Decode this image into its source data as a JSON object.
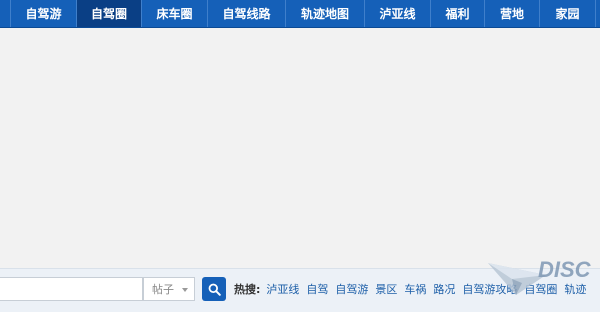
{
  "nav": {
    "items": [
      {
        "label": "自驾游",
        "active": false
      },
      {
        "label": "自驾圈",
        "active": true
      },
      {
        "label": "床车圈",
        "active": false
      },
      {
        "label": "自驾线路",
        "active": false
      },
      {
        "label": "轨迹地图",
        "active": false
      },
      {
        "label": "泸亚线",
        "active": false
      },
      {
        "label": "福利",
        "active": false
      },
      {
        "label": "营地",
        "active": false
      },
      {
        "label": "家园",
        "active": false
      }
    ]
  },
  "search": {
    "type_label": "帖子",
    "button_icon": "search-icon",
    "hot_label": "热搜:",
    "hot_links": [
      "泸亚线",
      "自驾",
      "自驾游",
      "景区",
      "车祸",
      "路况",
      "自驾游攻略",
      "自驾圈",
      "轨迹"
    ]
  },
  "logo": {
    "text": "DISC",
    "icon": "paper-plane-icon"
  },
  "colors": {
    "nav_bg": "#1560b8",
    "nav_active": "#0a3f85",
    "link": "#1d5fa8",
    "page_bg": "#f2f2f2"
  }
}
